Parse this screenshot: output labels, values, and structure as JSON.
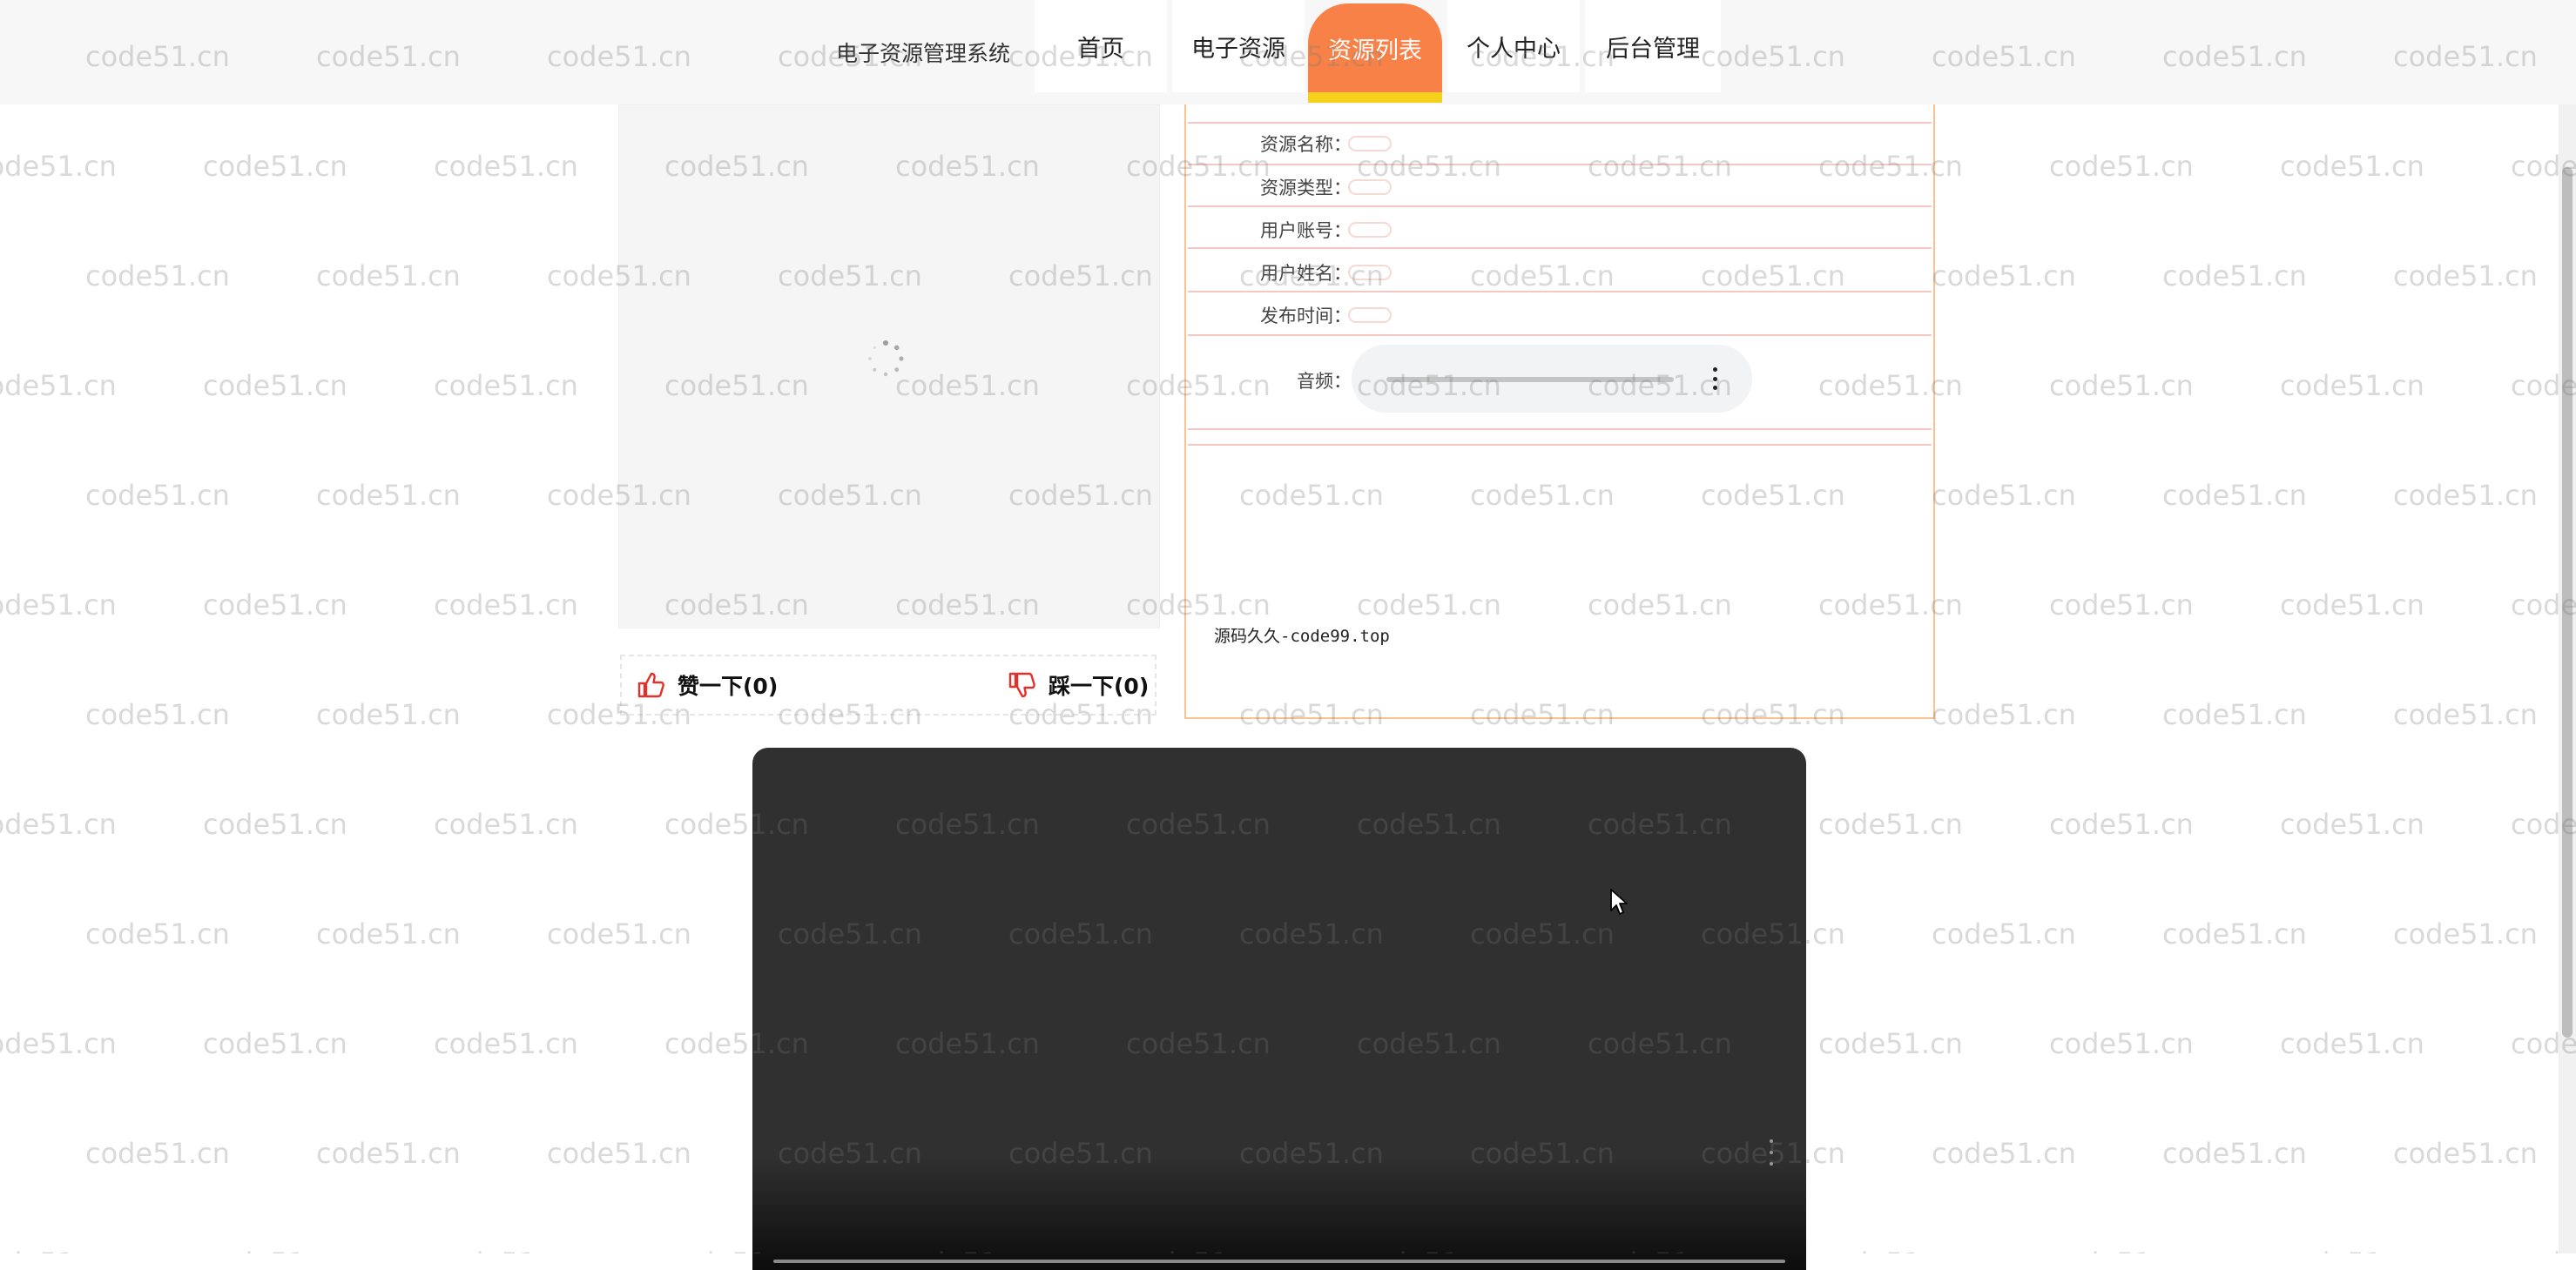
{
  "header": {
    "site_title": "电子资源管理系统",
    "nav": [
      {
        "label": "首页",
        "active": false
      },
      {
        "label": "电子资源",
        "active": false
      },
      {
        "label": "资源列表",
        "active": true
      },
      {
        "label": "个人中心",
        "active": false
      },
      {
        "label": "后台管理",
        "active": false
      }
    ]
  },
  "vote": {
    "like_label": "赞一下(0)",
    "dislike_label": "踩一下(0)"
  },
  "details": {
    "fields": [
      {
        "label": "资源名称：",
        "value": ""
      },
      {
        "label": "资源类型：",
        "value": ""
      },
      {
        "label": "用户账号：",
        "value": ""
      },
      {
        "label": "用户姓名：",
        "value": ""
      },
      {
        "label": "发布时间：",
        "value": ""
      }
    ],
    "audio_label": "音频：",
    "source_text": "源码久久-code99.top"
  },
  "watermark_text": "code51.cn",
  "colors": {
    "accent_orange": "#f88147",
    "accent_yellow": "#f5d11d",
    "panel_border": "#fbc28f",
    "video_bg": "#303030"
  },
  "icons": {
    "like": "thumbs-up-icon",
    "dislike": "thumbs-down-icon",
    "loading": "spinner-icon"
  }
}
